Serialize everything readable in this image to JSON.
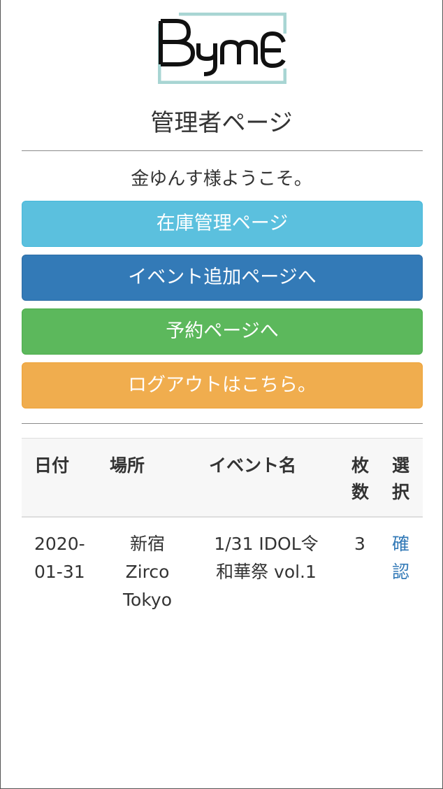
{
  "logo": {
    "text": "Byme",
    "accent_color": "#a8d5d3"
  },
  "page": {
    "title": "管理者ページ",
    "welcome": "金ゆんす様ようこそ。"
  },
  "buttons": {
    "stock": "在庫管理ページ",
    "add_event": "イベント追加ページへ",
    "reservation": "予約ページへ",
    "logout": "ログアウトはこちら。"
  },
  "table": {
    "headers": {
      "date": "日付",
      "place": "場所",
      "event_name": "イベント名",
      "count_l1": "枚",
      "count_l2": "数",
      "select_l1": "選",
      "select_l2": "択"
    },
    "rows": [
      {
        "date_l1": "2020-",
        "date_l2": "01-31",
        "place_l1": "新宿",
        "place_l2": "Zirco",
        "place_l3": "Tokyo",
        "event_l1": "1/31 IDOL令",
        "event_l2": "和華祭 vol.1",
        "count": "3",
        "action_l1": "確",
        "action_l2": "認"
      }
    ]
  },
  "colors": {
    "info": "#5bc0de",
    "primary": "#337ab7",
    "success": "#5cb85c",
    "warning": "#f0ad4e",
    "link": "#337ab7"
  }
}
